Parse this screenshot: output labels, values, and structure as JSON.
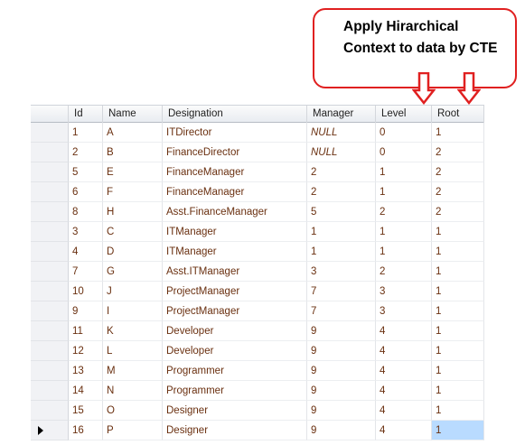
{
  "callout": {
    "line1": "Apply Hirarchical",
    "line2": "Context to data by CTE"
  },
  "columns": [
    "Id",
    "Name",
    "Designation",
    "Manager",
    "Level",
    "Root"
  ],
  "rows": [
    [
      "1",
      "A",
      "ITDirector",
      "NULL",
      "0",
      "1"
    ],
    [
      "2",
      "B",
      "FinanceDirector",
      "NULL",
      "0",
      "2"
    ],
    [
      "5",
      "E",
      "FinanceManager",
      "2",
      "1",
      "2"
    ],
    [
      "6",
      "F",
      "FinanceManager",
      "2",
      "1",
      "2"
    ],
    [
      "8",
      "H",
      "Asst.FinanceManager",
      "5",
      "2",
      "2"
    ],
    [
      "3",
      "C",
      "ITManager",
      "1",
      "1",
      "1"
    ],
    [
      "4",
      "D",
      "ITManager",
      "1",
      "1",
      "1"
    ],
    [
      "7",
      "G",
      "Asst.ITManager",
      "3",
      "2",
      "1"
    ],
    [
      "10",
      "J",
      "ProjectManager",
      "7",
      "3",
      "1"
    ],
    [
      "9",
      "I",
      "ProjectManager",
      "7",
      "3",
      "1"
    ],
    [
      "11",
      "K",
      "Developer",
      "9",
      "4",
      "1"
    ],
    [
      "12",
      "L",
      "Developer",
      "9",
      "4",
      "1"
    ],
    [
      "13",
      "M",
      "Programmer",
      "9",
      "4",
      "1"
    ],
    [
      "14",
      "N",
      "Programmer",
      "9",
      "4",
      "1"
    ],
    [
      "15",
      "O",
      "Designer",
      "9",
      "4",
      "1"
    ],
    [
      "16",
      "P",
      "Designer",
      "9",
      "4",
      "1"
    ]
  ],
  "selected_row_index": 15,
  "colors": {
    "callout_border": "#e02020",
    "cell_text": "#6a3010",
    "selection": "#b9dbff"
  }
}
